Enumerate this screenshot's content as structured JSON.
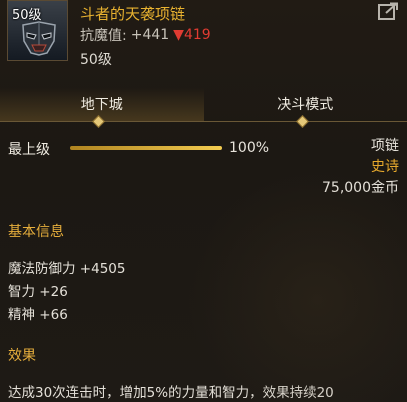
{
  "item": {
    "level_badge": "50级",
    "name": "斗者的天袭项链",
    "resist_label": "抗魔值:",
    "resist_value": "+441",
    "resist_down_arrow": "▼",
    "resist_down_value": "419",
    "level_text": "50级"
  },
  "tabs": [
    {
      "label": "地下城",
      "active": true
    },
    {
      "label": "决斗模式",
      "active": false
    }
  ],
  "level_row": {
    "label": "最上级",
    "progress_percent": 100,
    "percent_text": "100%"
  },
  "meta": {
    "type": "项链",
    "rarity": "史诗",
    "price": "75,000金币"
  },
  "basic_info": {
    "title": "基本信息",
    "stats": [
      "魔法防御力 +4505",
      "智力 +26",
      "精神 +66"
    ]
  },
  "effect": {
    "title": "效果",
    "text": "达成30次连击时，增加5%的力量和智力，效果持续20"
  },
  "colors": {
    "item_name": "#e8b230",
    "rarity": "#e7a92c",
    "section_title": "#e6ae3c",
    "down_value": "#e03b32"
  },
  "icons": {
    "item": "demon-mask-icon",
    "share": "share-icon",
    "tab_marker": "diamond-icon"
  }
}
